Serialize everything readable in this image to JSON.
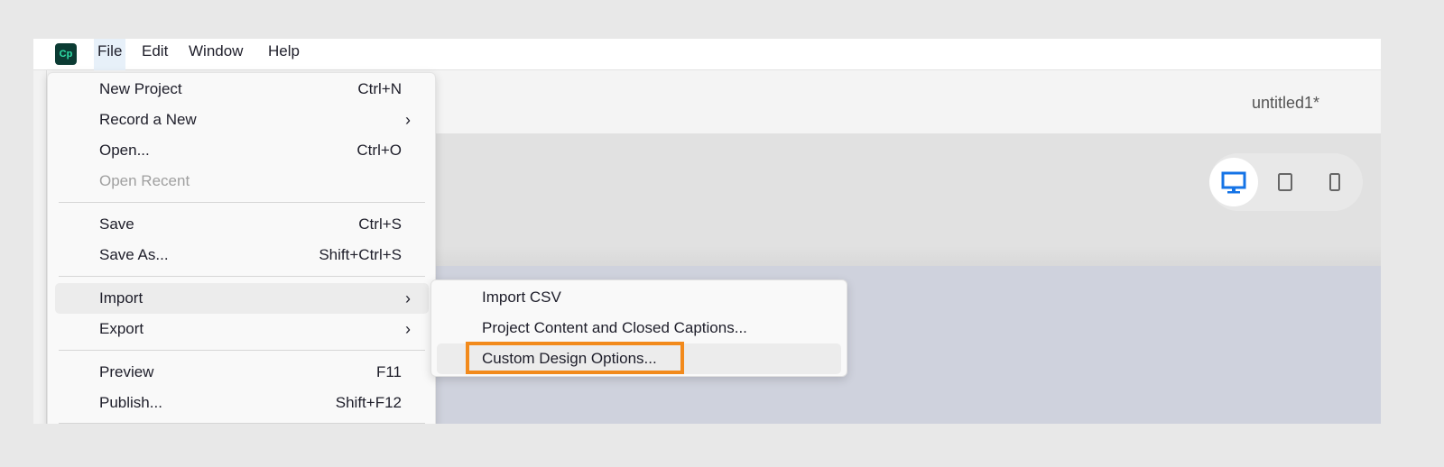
{
  "app": {
    "logo_text": "Cp",
    "document_title": "untitled1*"
  },
  "menubar": {
    "items": [
      {
        "label": "File"
      },
      {
        "label": "Edit"
      },
      {
        "label": "Window"
      },
      {
        "label": "Help"
      }
    ]
  },
  "file_menu": {
    "items": [
      {
        "label": "New Project",
        "shortcut": "Ctrl+N"
      },
      {
        "label": "Record a New",
        "submenu": true
      },
      {
        "label": "Open...",
        "shortcut": "Ctrl+O"
      },
      {
        "label": "Open Recent",
        "disabled": true
      },
      {
        "label": "Save",
        "shortcut": "Ctrl+S"
      },
      {
        "label": "Save As...",
        "shortcut": "Shift+Ctrl+S"
      },
      {
        "label": "Import",
        "submenu": true,
        "highlighted": true
      },
      {
        "label": "Export",
        "submenu": true
      },
      {
        "label": "Preview",
        "shortcut": "F11"
      },
      {
        "label": "Publish...",
        "shortcut": "Shift+F12"
      }
    ],
    "submenu_arrow": "›"
  },
  "import_submenu": {
    "items": [
      {
        "label": "Import CSV"
      },
      {
        "label": "Project Content and Closed Captions..."
      },
      {
        "label": "Custom Design Options...",
        "highlighted": true
      }
    ]
  },
  "device_preview": {
    "options": [
      {
        "icon": "desktop-icon",
        "selected": true
      },
      {
        "icon": "tablet-icon"
      },
      {
        "icon": "mobile-icon"
      }
    ]
  },
  "colors": {
    "highlight_box": "#f28a1c",
    "selected_device": "#1473e6",
    "logo_bg": "#0b3b33"
  }
}
